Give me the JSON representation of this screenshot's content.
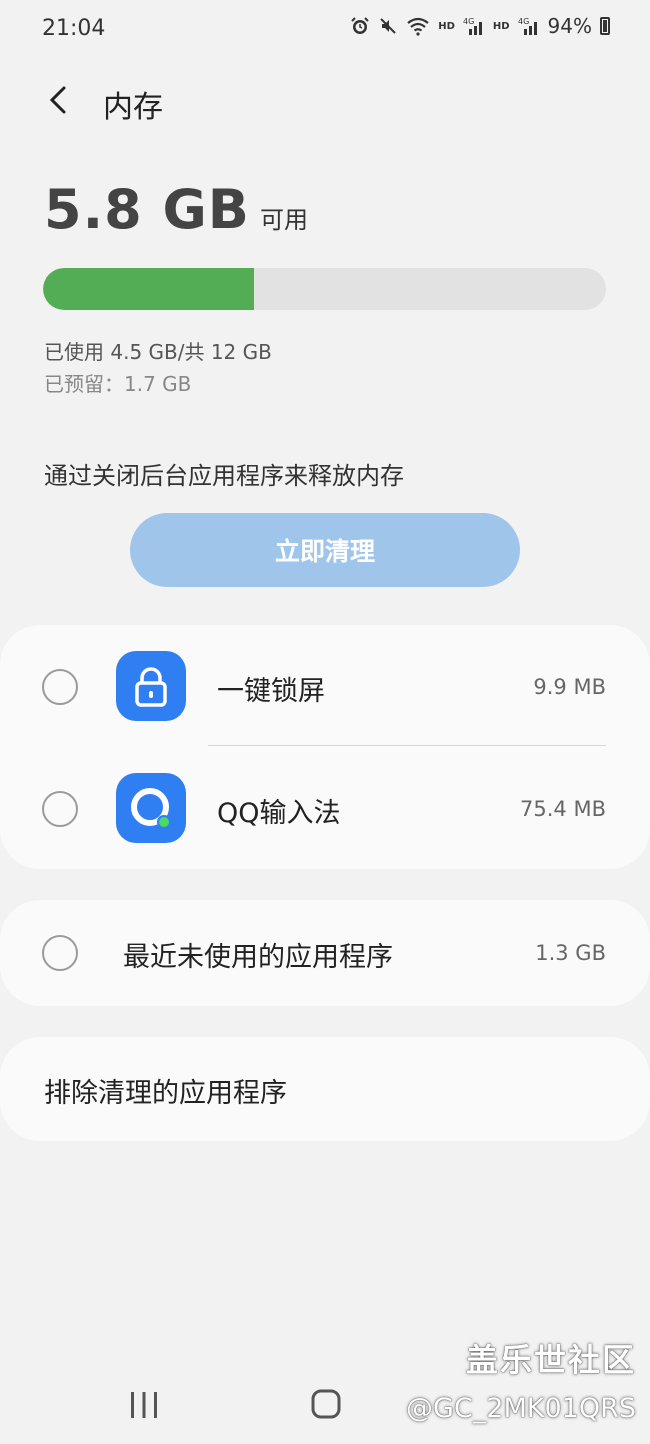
{
  "status_bar": {
    "time": "21:04",
    "battery_percent": "94%",
    "icons": [
      "alarm-icon",
      "mute-icon",
      "wifi-icon",
      "hd-volte-icon",
      "signal-4g-icon",
      "hd-volte-icon",
      "signal-4g-icon",
      "battery-icon"
    ],
    "hd_label": "HD",
    "network_label": "4G"
  },
  "header": {
    "title": "内存"
  },
  "memory": {
    "available_value": "5.8 GB",
    "available_label": "可用",
    "used_fraction": 0.375,
    "used_text": "已使用 4.5 GB/共 12 GB",
    "reserved_text": "已预留：1.7 GB",
    "bar_used_color": "#52ad55",
    "bar_track_color": "#e2e2e2"
  },
  "clean": {
    "hint": "通过关闭后台应用程序来释放内存",
    "button_label": "立即清理",
    "button_color": "#9fc6ea"
  },
  "apps": [
    {
      "name": "一键锁屏",
      "size": "9.9 MB",
      "icon": "lock-icon"
    },
    {
      "name": "QQ输入法",
      "size": "75.4 MB",
      "icon": "qq-input-icon"
    }
  ],
  "recent_unused": {
    "label": "最近未使用的应用程序",
    "size": "1.3 GB"
  },
  "exclude": {
    "label": "排除清理的应用程序"
  },
  "watermark": {
    "line1": "盖乐世社区",
    "line2": "@GC_2MK01QRS"
  },
  "nav": {
    "icons": [
      "recent-apps-icon",
      "home-icon"
    ]
  }
}
